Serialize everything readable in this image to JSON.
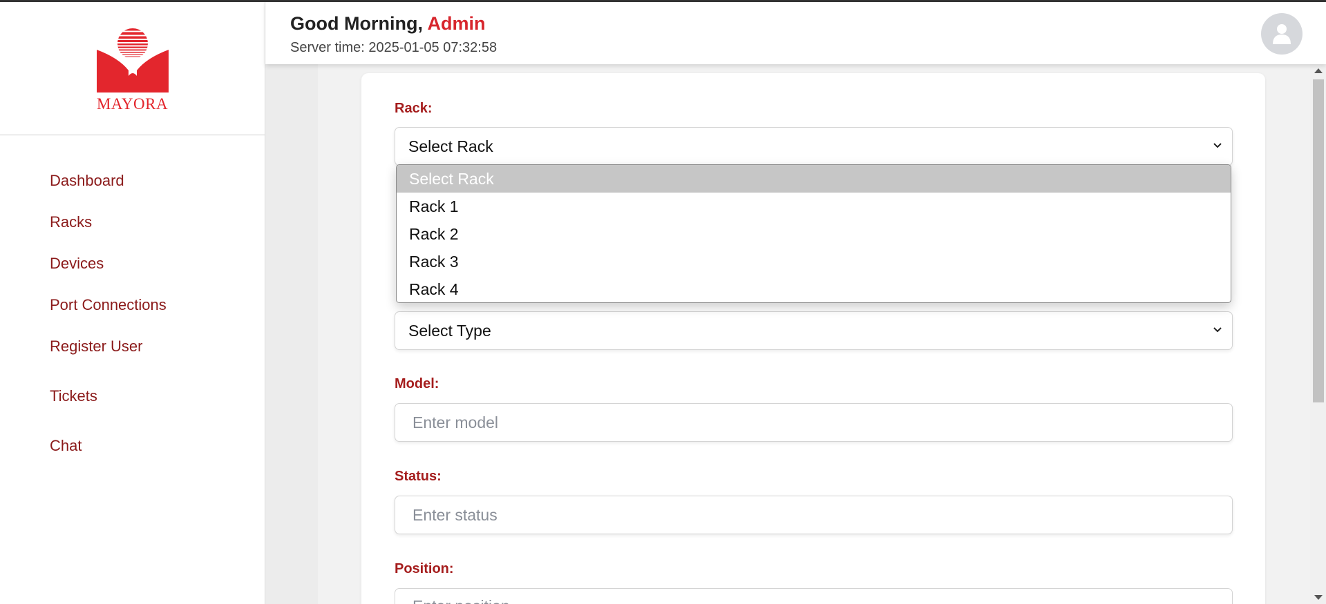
{
  "logo": {
    "text": "MAYORA",
    "color": "#e3262d"
  },
  "sidebar": {
    "items": [
      {
        "label": "Dashboard"
      },
      {
        "label": "Racks"
      },
      {
        "label": "Devices"
      },
      {
        "label": "Port Connections"
      },
      {
        "label": "Register User"
      },
      {
        "label": "Tickets"
      },
      {
        "label": "Chat"
      }
    ]
  },
  "header": {
    "greeting": "Good Morning,",
    "user_name": "Admin",
    "server_time": "Server time: 2025-01-05 07:32:58",
    "avatar_icon": "user-avatar-icon"
  },
  "form": {
    "rack": {
      "label": "Rack:",
      "value": "Select Rack"
    },
    "type": {
      "value": "Select Type"
    },
    "model": {
      "label": "Model:",
      "placeholder": "Enter model"
    },
    "status": {
      "label": "Status:",
      "placeholder": "Enter status"
    },
    "position": {
      "label": "Position:",
      "placeholder": "Enter position"
    }
  },
  "rack_dropdown": {
    "options": [
      "Select Rack",
      "Rack 1",
      "Rack 2",
      "Rack 3",
      "Rack 4"
    ],
    "selected_index": 0
  },
  "colors": {
    "accent": "#d7262d",
    "label": "#a51d1d",
    "nav": "#8b1a1a"
  }
}
